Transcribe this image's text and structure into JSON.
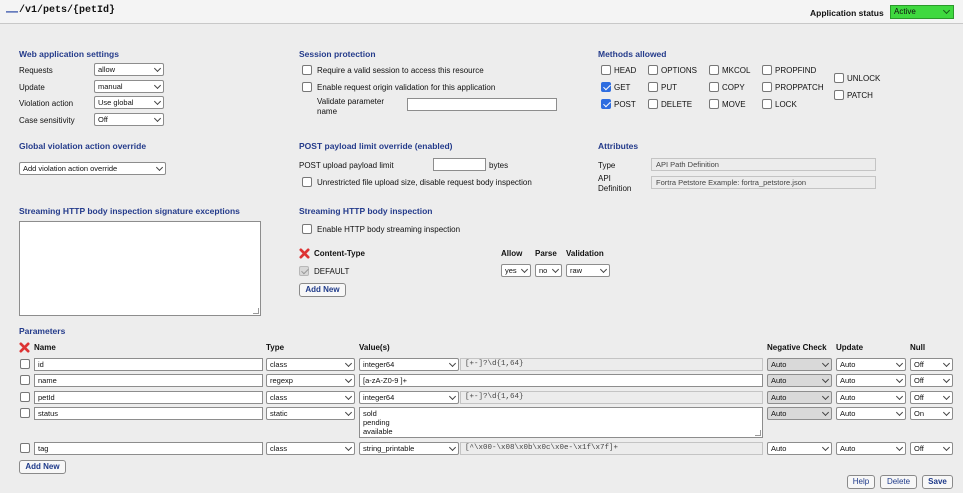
{
  "header": {
    "path": "/v1/pets/{petId}",
    "collapse_glyph": "—",
    "status_label": "Application status",
    "status_value": "Active",
    "status_color": "#3fd93f"
  },
  "web_app": {
    "title": "Web application settings",
    "requests_label": "Requests",
    "requests_value": "allow",
    "update_label": "Update",
    "update_value": "manual",
    "violation_label": "Violation action",
    "violation_value": "Use global",
    "case_label": "Case sensitivity",
    "case_value": "Off"
  },
  "session": {
    "title": "Session protection",
    "require_valid": "Require a valid session to access this resource",
    "origin_validation": "Enable request origin validation for this application",
    "validate_param_label": "Validate parameter\nname",
    "validate_param_value": ""
  },
  "methods": {
    "title": "Methods allowed",
    "items": [
      {
        "label": "HEAD",
        "checked": false
      },
      {
        "label": "OPTIONS",
        "checked": false
      },
      {
        "label": "MKCOL",
        "checked": false
      },
      {
        "label": "PROPFIND",
        "checked": false
      },
      {
        "label": "UNLOCK",
        "checked": false
      },
      {
        "label": "GET",
        "checked": true
      },
      {
        "label": "PUT",
        "checked": false
      },
      {
        "label": "COPY",
        "checked": false
      },
      {
        "label": "PROPPATCH",
        "checked": false
      },
      {
        "label": "PATCH",
        "checked": false
      },
      {
        "label": "POST",
        "checked": true
      },
      {
        "label": "DELETE",
        "checked": false
      },
      {
        "label": "MOVE",
        "checked": false
      },
      {
        "label": "LOCK",
        "checked": false
      }
    ]
  },
  "global_override": {
    "title": "Global violation action override",
    "select_value": "Add violation action override"
  },
  "post_limit": {
    "title": "POST payload limit override (enabled)",
    "upload_label": "POST upload payload limit",
    "upload_value": "",
    "units": "bytes",
    "unrestricted": "Unrestricted file upload size, disable request body inspection"
  },
  "attributes": {
    "title": "Attributes",
    "type_label": "Type",
    "type_value": "API Path Definition",
    "def_label": "API\nDefinition",
    "def_value": "Fortra Petstore Example: fortra_petstore.json"
  },
  "sig_exceptions": {
    "title": "Streaming HTTP body inspection signature exceptions"
  },
  "streaming": {
    "title": "Streaming HTTP body inspection",
    "enable_label": "Enable HTTP body streaming inspection",
    "col_content_type": "Content-Type",
    "col_allow": "Allow",
    "col_parse": "Parse",
    "col_validation": "Validation",
    "row_label": "DEFAULT",
    "row_allow": "yes",
    "row_parse": "no",
    "row_validation": "raw",
    "add_new": "Add New"
  },
  "parameters": {
    "title": "Parameters",
    "headers": {
      "name": "Name",
      "type": "Type",
      "values": "Value(s)",
      "negative": "Negative Check",
      "update": "Update",
      "null": "Null"
    },
    "rows": [
      {
        "name": "id",
        "type": "class",
        "value": "integer64",
        "regex": "[+-]?\\d{1,64}",
        "negative": "Auto",
        "update": "Auto",
        "null": "Off"
      },
      {
        "name": "name",
        "type": "regexp",
        "value": "[a-zA-Z0-9 ]+",
        "regex": "",
        "negative": "Auto",
        "update": "Auto",
        "null": "Off"
      },
      {
        "name": "petId",
        "type": "class",
        "value": "integer64",
        "regex": "[+-]?\\d{1,64}",
        "negative": "Auto",
        "update": "Auto",
        "null": "Off"
      },
      {
        "name": "status",
        "type": "static",
        "value": "sold\npending\navailable",
        "regex": "",
        "negative": "Auto",
        "update": "Auto",
        "null": "On"
      },
      {
        "name": "tag",
        "type": "class",
        "value": "string_printable",
        "regex": "[^\\x00-\\x08\\x0b\\x0c\\x0e-\\x1f\\x7f]+",
        "negative": "Auto",
        "update": "Auto",
        "null": "Off"
      }
    ],
    "add_new": "Add New"
  },
  "footer": {
    "help": "Help",
    "delete": "Delete",
    "save": "Save"
  }
}
